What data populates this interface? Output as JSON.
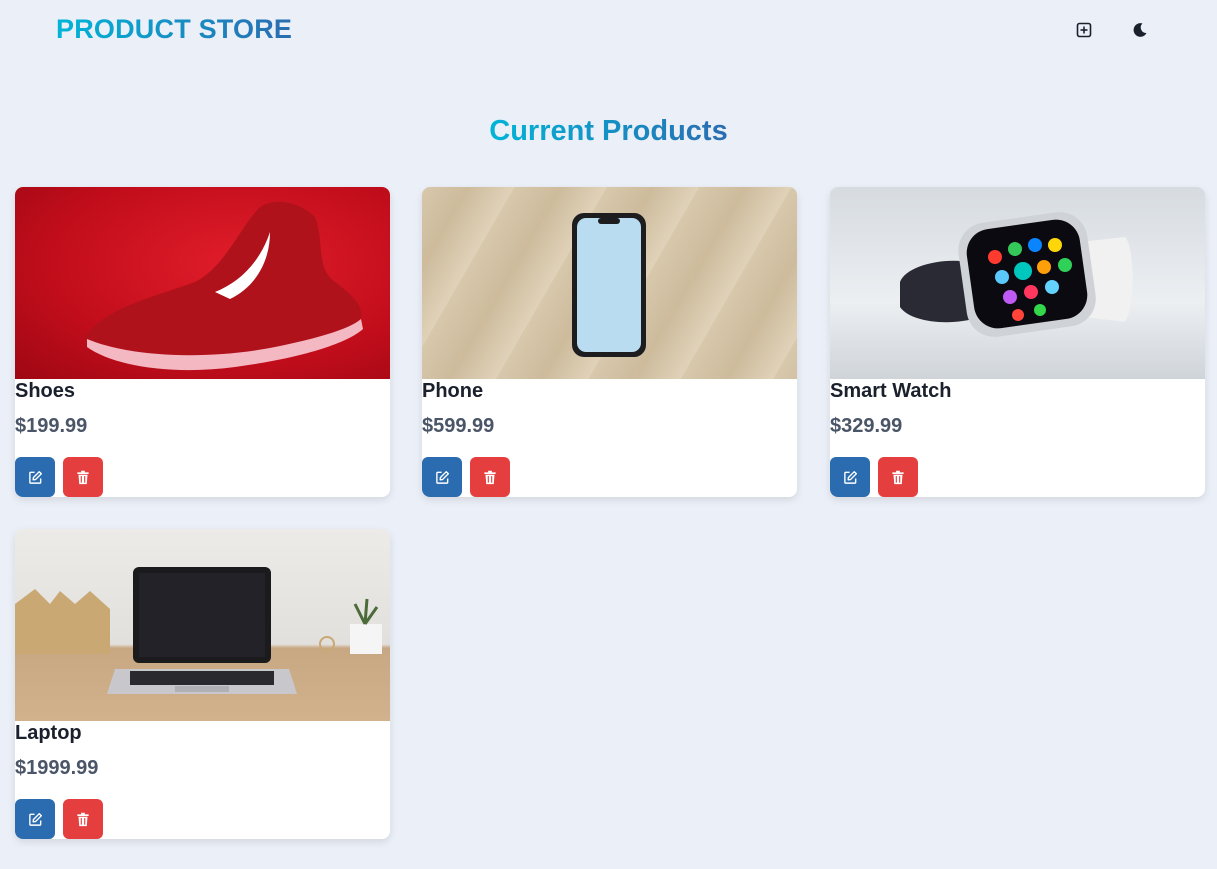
{
  "navbar": {
    "brand": "PRODUCT STORE",
    "create_icon": "plus-square-icon",
    "theme_icon": "moon-icon"
  },
  "main": {
    "title": "Current Products"
  },
  "products": [
    {
      "name": "Shoes",
      "price": "$199.99",
      "image": "red-sneaker"
    },
    {
      "name": "Phone",
      "price": "$599.99",
      "image": "smartphone-on-wood"
    },
    {
      "name": "Smart Watch",
      "price": "$329.99",
      "image": "smart-watch"
    },
    {
      "name": "Laptop",
      "price": "$1999.99",
      "image": "laptop-on-desk"
    }
  ],
  "colors": {
    "background": "#ebeff7",
    "edit": "#2b6cb0",
    "delete": "#e53e3e",
    "gradient_start": "#00b5d8",
    "gradient_end": "#2b6cb0"
  }
}
